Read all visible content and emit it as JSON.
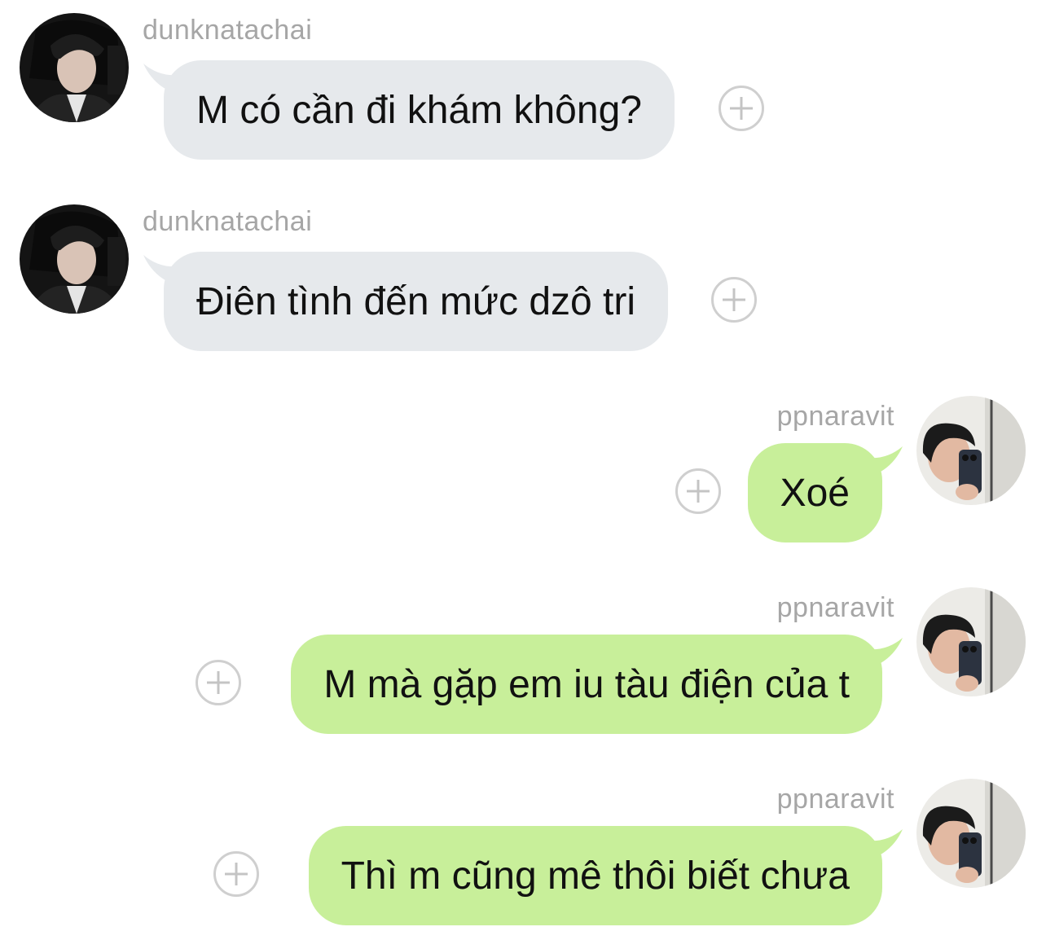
{
  "conversation": {
    "messages": [
      {
        "sender": "dunknatachai",
        "text": "M có cần đi khám không?",
        "direction": "incoming"
      },
      {
        "sender": "dunknatachai",
        "text": "Điên tình đến mức dzô tri",
        "direction": "incoming"
      },
      {
        "sender": "ppnaravit",
        "text": "Xoé",
        "direction": "outgoing"
      },
      {
        "sender": "ppnaravit",
        "text": "M mà gặp em iu tàu điện của t",
        "direction": "outgoing"
      },
      {
        "sender": "ppnaravit",
        "text": "Thì m cũng mê thôi biết chưa",
        "direction": "outgoing"
      }
    ]
  },
  "colors": {
    "incoming_bubble": "#e6e9ec",
    "outgoing_bubble": "#c8ef9a",
    "sender_name": "#a6a6a6",
    "message_text": "#111111",
    "add_button": "#cfcfcf"
  },
  "icons": {
    "add_reaction": "plus-circle-icon"
  }
}
